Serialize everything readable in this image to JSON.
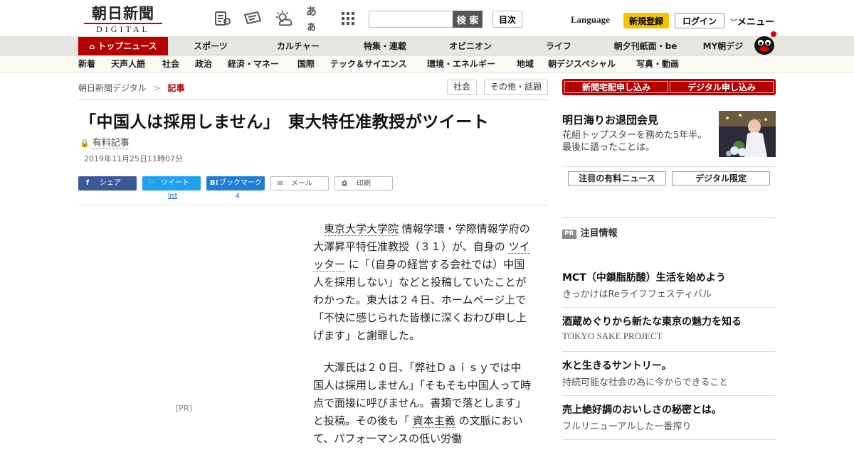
{
  "header": {
    "logo_main": "朝日新聞",
    "logo_sub": "DIGITAL",
    "icon_aa": "あぁ",
    "search_placeholder": "",
    "search_label": "検 索",
    "toc_label": "目次",
    "language_label": "Language",
    "signup_label": "新規登録",
    "login_label": "ログイン",
    "menu_label": "メニュー"
  },
  "nav": {
    "items": [
      "トップニュース",
      "スポーツ",
      "カルチャー",
      "特集・連載",
      "オピニオン",
      "ライフ",
      "朝夕刊紙面・be",
      "MY朝デジ"
    ]
  },
  "subnav": {
    "items": [
      "新着",
      "天声人語",
      "社会",
      "政治",
      "経済・マネー",
      "国際",
      "テック＆サイエンス",
      "環境・エネルギー",
      "地域",
      "朝デジスペシャル",
      "写真・動画"
    ]
  },
  "breadcrumb": {
    "home": "朝日新聞デジタル",
    "sep": ">",
    "current": "記事"
  },
  "tags": [
    "社会",
    "その他・話題"
  ],
  "article": {
    "headline": "「中国人は採用しません」　東大特任准教授がツイート",
    "paid_label": "有料記事",
    "date": "2019年11月25日11時07分",
    "pr_label": "[PR]",
    "p1": {
      "link1": "東京大学大学院",
      "text1": " 情報学環・学際情報学府の大澤昇平特任准教授（３１）が、自身の ",
      "link2": "ツイッター",
      "text2": " に「（自身の経営する会社では）中国人を採用しない」などと投稿していたことがわかった。東大は２４日、ホームページ上で「不快に感じられた皆様に深くおわび申し上げます」と謝罪した。"
    },
    "p2": {
      "text1": "大澤氏は２０日、「弊社Ｄａｉｓｙでは中国人は採用しません」「そもそも中国人って時点で面接に呼びません。書類で落とします」と投稿。その後も「 ",
      "link1": "資本主義",
      "text2": " の文脈において、パフォーマンスの低い労働"
    }
  },
  "share": {
    "facebook": "シェア",
    "twitter": "ツイート",
    "hatena": "ブックマーク",
    "mail": "メール",
    "print": "印刷",
    "twitter_count": "list",
    "hatena_count": "4"
  },
  "sidebar": {
    "apply_newspaper": "新聞宅配申し込み",
    "apply_digital": "デジタル申し込み",
    "promo_title": "明日海りお退団会見",
    "promo_desc": "花組トップスターを務めた5年半。最後に語ったことは。",
    "tab_paid_news": "注目の有料ニュース",
    "tab_digital_only": "デジタル限定",
    "pr_badge": "PR",
    "pr_heading": "注目情報",
    "ads": [
      {
        "title": "MCT（中鎖脂肪酸）生活を始めよう",
        "sub": "きっかけはReライフフェスティバル"
      },
      {
        "title": "酒蔵めぐりから新たな東京の魅力を知る",
        "sub": "TOKYO SAKE PROJECT"
      },
      {
        "title": "水と生きるサントリー。",
        "sub": "持続可能な社会の為に今からできること"
      },
      {
        "title": "売上絶好調のおいしさの秘密とは。",
        "sub": "フルリニューアルした一番搾り"
      }
    ]
  },
  "colors": {
    "brand_red": "#b40000",
    "signup_yellow": "#f3c300",
    "facebook": "#3b5998",
    "twitter": "#1da1f2",
    "hatena": "#1f7fd8"
  }
}
